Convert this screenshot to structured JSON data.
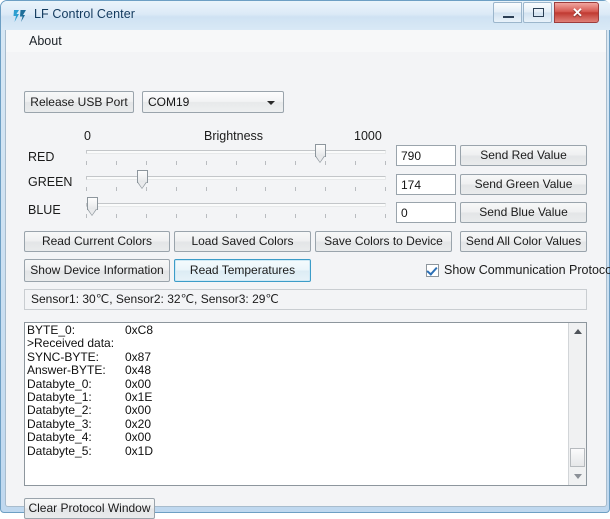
{
  "window": {
    "title": "LF Control Center",
    "icon": "app-icon",
    "controls": {
      "minimize": "minimize-icon",
      "maximize": "maximize-icon",
      "close": "✕"
    }
  },
  "menu": {
    "items": [
      {
        "label": "About"
      }
    ]
  },
  "connection": {
    "release_button": "Release USB Port",
    "port_selected": "COM19",
    "port_options": [
      "COM19"
    ]
  },
  "brightness": {
    "scale_min": "0",
    "scale_title": "Brightness",
    "scale_max": "1000",
    "range": [
      0,
      1000
    ],
    "channels": [
      {
        "label": "RED",
        "value": "790",
        "value_num": 790,
        "send_label": "Send Red Value"
      },
      {
        "label": "GREEN",
        "value": "174",
        "value_num": 174,
        "send_label": "Send Green Value"
      },
      {
        "label": "BLUE",
        "value": "0",
        "value_num": 0,
        "send_label": "Send Blue Value"
      }
    ],
    "send_all_label": "Send All Color Values"
  },
  "actions": {
    "read_current_colors": "Read Current Colors",
    "load_saved_colors": "Load Saved Colors",
    "save_colors_to_device": "Save Colors to Device",
    "show_device_information": "Show Device Information",
    "read_temperatures": "Read Temperatures"
  },
  "protocol_toggle": {
    "label": "Show Communication Protocol",
    "checked": true
  },
  "status": {
    "text": "Sensor1: 30℃, Sensor2: 32℃, Sensor3: 29℃"
  },
  "log": {
    "lines": [
      {
        "key": "BYTE_0:",
        "value": "0xC8"
      },
      {
        "key": ">Received data:",
        "value": ""
      },
      {
        "key": "SYNC-BYTE:",
        "value": "0x87"
      },
      {
        "key": "Answer-BYTE:",
        "value": "0x48"
      },
      {
        "key": "Databyte_0:",
        "value": "0x00"
      },
      {
        "key": "Databyte_1:",
        "value": "0x1E"
      },
      {
        "key": "Databyte_2:",
        "value": "0x00"
      },
      {
        "key": "Databyte_3:",
        "value": "0x20"
      },
      {
        "key": "Databyte_4:",
        "value": "0x00"
      },
      {
        "key": "Databyte_5:",
        "value": "0x1D"
      }
    ],
    "clear_button": "Clear Protocol Window",
    "scroll_up_icon": "scroll-up-arrow",
    "scroll_down_icon": "scroll-down-arrow"
  },
  "colors": {
    "accent": "#3c9cc8",
    "titlebar": "#d9e9f6",
    "client_bg": "#f3f4f6",
    "close_button": "#c03a32"
  }
}
